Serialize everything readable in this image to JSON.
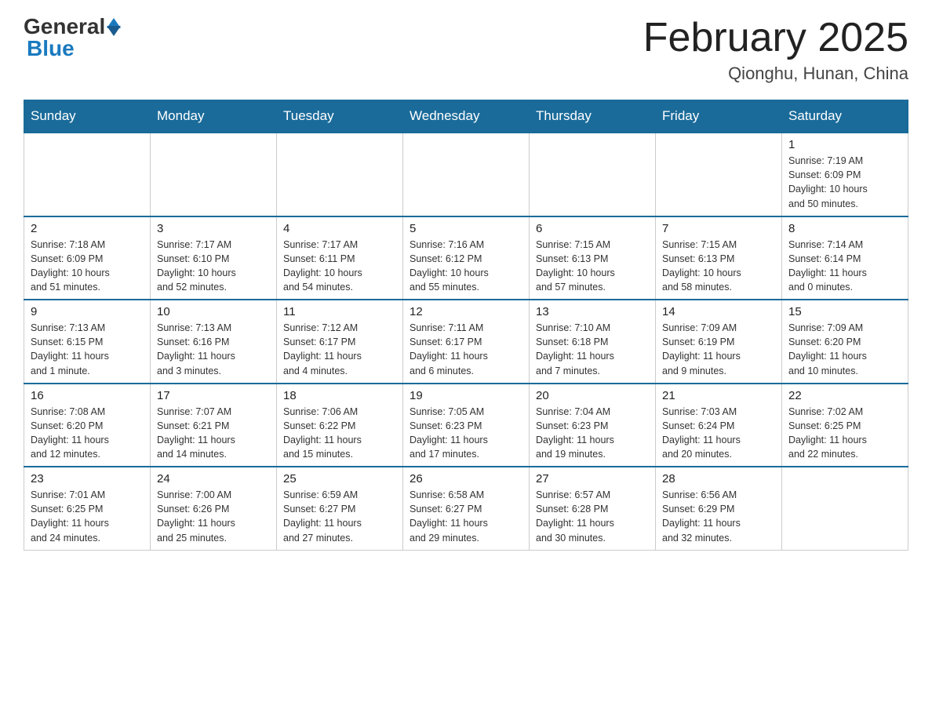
{
  "header": {
    "logo_general": "General",
    "logo_blue": "Blue",
    "month_title": "February 2025",
    "location": "Qionghu, Hunan, China"
  },
  "weekdays": [
    "Sunday",
    "Monday",
    "Tuesday",
    "Wednesday",
    "Thursday",
    "Friday",
    "Saturday"
  ],
  "weeks": [
    [
      {
        "day": "",
        "info": ""
      },
      {
        "day": "",
        "info": ""
      },
      {
        "day": "",
        "info": ""
      },
      {
        "day": "",
        "info": ""
      },
      {
        "day": "",
        "info": ""
      },
      {
        "day": "",
        "info": ""
      },
      {
        "day": "1",
        "info": "Sunrise: 7:19 AM\nSunset: 6:09 PM\nDaylight: 10 hours\nand 50 minutes."
      }
    ],
    [
      {
        "day": "2",
        "info": "Sunrise: 7:18 AM\nSunset: 6:09 PM\nDaylight: 10 hours\nand 51 minutes."
      },
      {
        "day": "3",
        "info": "Sunrise: 7:17 AM\nSunset: 6:10 PM\nDaylight: 10 hours\nand 52 minutes."
      },
      {
        "day": "4",
        "info": "Sunrise: 7:17 AM\nSunset: 6:11 PM\nDaylight: 10 hours\nand 54 minutes."
      },
      {
        "day": "5",
        "info": "Sunrise: 7:16 AM\nSunset: 6:12 PM\nDaylight: 10 hours\nand 55 minutes."
      },
      {
        "day": "6",
        "info": "Sunrise: 7:15 AM\nSunset: 6:13 PM\nDaylight: 10 hours\nand 57 minutes."
      },
      {
        "day": "7",
        "info": "Sunrise: 7:15 AM\nSunset: 6:13 PM\nDaylight: 10 hours\nand 58 minutes."
      },
      {
        "day": "8",
        "info": "Sunrise: 7:14 AM\nSunset: 6:14 PM\nDaylight: 11 hours\nand 0 minutes."
      }
    ],
    [
      {
        "day": "9",
        "info": "Sunrise: 7:13 AM\nSunset: 6:15 PM\nDaylight: 11 hours\nand 1 minute."
      },
      {
        "day": "10",
        "info": "Sunrise: 7:13 AM\nSunset: 6:16 PM\nDaylight: 11 hours\nand 3 minutes."
      },
      {
        "day": "11",
        "info": "Sunrise: 7:12 AM\nSunset: 6:17 PM\nDaylight: 11 hours\nand 4 minutes."
      },
      {
        "day": "12",
        "info": "Sunrise: 7:11 AM\nSunset: 6:17 PM\nDaylight: 11 hours\nand 6 minutes."
      },
      {
        "day": "13",
        "info": "Sunrise: 7:10 AM\nSunset: 6:18 PM\nDaylight: 11 hours\nand 7 minutes."
      },
      {
        "day": "14",
        "info": "Sunrise: 7:09 AM\nSunset: 6:19 PM\nDaylight: 11 hours\nand 9 minutes."
      },
      {
        "day": "15",
        "info": "Sunrise: 7:09 AM\nSunset: 6:20 PM\nDaylight: 11 hours\nand 10 minutes."
      }
    ],
    [
      {
        "day": "16",
        "info": "Sunrise: 7:08 AM\nSunset: 6:20 PM\nDaylight: 11 hours\nand 12 minutes."
      },
      {
        "day": "17",
        "info": "Sunrise: 7:07 AM\nSunset: 6:21 PM\nDaylight: 11 hours\nand 14 minutes."
      },
      {
        "day": "18",
        "info": "Sunrise: 7:06 AM\nSunset: 6:22 PM\nDaylight: 11 hours\nand 15 minutes."
      },
      {
        "day": "19",
        "info": "Sunrise: 7:05 AM\nSunset: 6:23 PM\nDaylight: 11 hours\nand 17 minutes."
      },
      {
        "day": "20",
        "info": "Sunrise: 7:04 AM\nSunset: 6:23 PM\nDaylight: 11 hours\nand 19 minutes."
      },
      {
        "day": "21",
        "info": "Sunrise: 7:03 AM\nSunset: 6:24 PM\nDaylight: 11 hours\nand 20 minutes."
      },
      {
        "day": "22",
        "info": "Sunrise: 7:02 AM\nSunset: 6:25 PM\nDaylight: 11 hours\nand 22 minutes."
      }
    ],
    [
      {
        "day": "23",
        "info": "Sunrise: 7:01 AM\nSunset: 6:25 PM\nDaylight: 11 hours\nand 24 minutes."
      },
      {
        "day": "24",
        "info": "Sunrise: 7:00 AM\nSunset: 6:26 PM\nDaylight: 11 hours\nand 25 minutes."
      },
      {
        "day": "25",
        "info": "Sunrise: 6:59 AM\nSunset: 6:27 PM\nDaylight: 11 hours\nand 27 minutes."
      },
      {
        "day": "26",
        "info": "Sunrise: 6:58 AM\nSunset: 6:27 PM\nDaylight: 11 hours\nand 29 minutes."
      },
      {
        "day": "27",
        "info": "Sunrise: 6:57 AM\nSunset: 6:28 PM\nDaylight: 11 hours\nand 30 minutes."
      },
      {
        "day": "28",
        "info": "Sunrise: 6:56 AM\nSunset: 6:29 PM\nDaylight: 11 hours\nand 32 minutes."
      },
      {
        "day": "",
        "info": ""
      }
    ]
  ]
}
